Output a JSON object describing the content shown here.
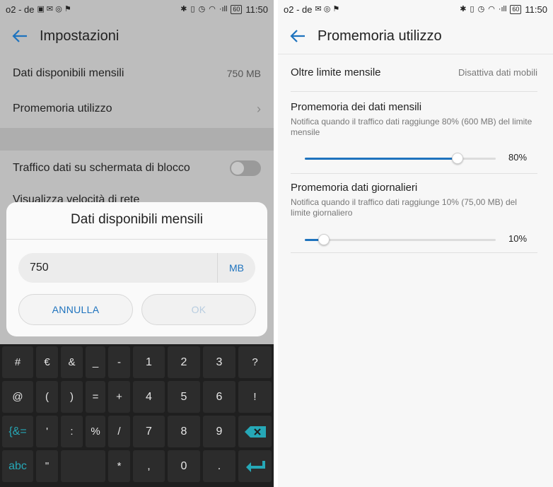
{
  "left": {
    "status": {
      "carrier": "o2 - de",
      "signal": "·ıll",
      "battery": "60",
      "time": "11:50"
    },
    "appbar_title": "Impostazioni",
    "rows": {
      "monthly_data_label": "Dati disponibili mensili",
      "monthly_data_value": "750 MB",
      "usage_reminder_label": "Promemoria utilizzo",
      "lockscreen_traffic_label": "Traffico dati su schermata di blocco",
      "network_speed_label": "Visualizza velocità di rete"
    },
    "dialog": {
      "title": "Dati disponibili mensili",
      "input_value": "750",
      "unit": "MB",
      "cancel_label": "ANNULLA",
      "ok_label": "OK"
    },
    "keyboard": {
      "row1": [
        "#",
        "€",
        "&",
        "_",
        "-",
        "1",
        "2",
        "3",
        "?"
      ],
      "row2": [
        "@",
        "(",
        ")",
        "=",
        "+",
        "4",
        "5",
        "6",
        "!"
      ],
      "row3": [
        "{&=",
        "'",
        ":",
        "%",
        "/",
        "7",
        "8",
        "9"
      ],
      "row4": [
        "abc",
        "\"",
        "*",
        ",",
        "0",
        "."
      ]
    }
  },
  "right": {
    "status": {
      "carrier": "o2 - de",
      "signal": "·ıll",
      "battery": "60",
      "time": "11:50"
    },
    "appbar_title": "Promemoria utilizzo",
    "over_limit_label": "Oltre limite mensile",
    "over_limit_value": "Disattiva dati mobili",
    "monthly_reminder": {
      "title": "Promemoria dei dati mensili",
      "desc": "Notifica quando il traffico dati raggiunge 80% (600 MB) del limite mensile",
      "percent_label": "80%",
      "level": 0.8
    },
    "daily_reminder": {
      "title": "Promemoria dati giornalieri",
      "desc": "Notifica quando il traffico dati raggiunge 10% (75,00 MB) del limite giornaliero",
      "percent_label": "10%",
      "level": 0.1
    }
  },
  "colors": {
    "accent": "#1e73be",
    "keyboard_accent": "#26a8b7"
  }
}
